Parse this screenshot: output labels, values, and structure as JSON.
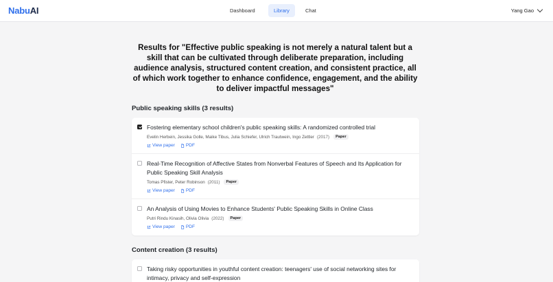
{
  "app": {
    "logo_part1": "Nabu",
    "logo_part2": "AI",
    "user_name": "Yang Gao"
  },
  "nav": {
    "items": [
      {
        "label": "Dashboard"
      },
      {
        "label": "Library"
      },
      {
        "label": "Chat"
      }
    ],
    "active": "Library"
  },
  "results_heading": "Results for \"Effective public speaking is not merely a natural talent but a skill that can be cultivated through deliberate preparation, including audience analysis, structured content creation, and consistent practice, all of which work together to enhance confidence, engagement, and the ability to deliver impactful messages\"",
  "sections": [
    {
      "title": "Public speaking skills (3 results)",
      "items": [
        {
          "checked": true,
          "title": "Fostering elementary school children's public speaking skills: A randomized controlled trial",
          "authors": "Evelin Herbein, Jessika Golle, Maike Tibus, Julia Schiefer, Ulrich Trautwein, Ingo Zettler",
          "year": "(2017)",
          "type": "Paper",
          "view_label": "View paper",
          "pdf_label": "PDF"
        },
        {
          "checked": false,
          "title": "Real-Time Recognition of Affective States from Nonverbal Features of Speech and Its Application for Public Speaking Skill Analysis",
          "authors": "Tomas Pfister, Peter Robinson",
          "year": "(2011)",
          "type": "Paper",
          "view_label": "View paper",
          "pdf_label": "PDF"
        },
        {
          "checked": false,
          "title": "An Analysis of Using Movies to Enhance Students' Public Speaking Skills in Online Class",
          "authors": "Putri Rindu Kinasih, Olivia Olivia",
          "year": "(2022)",
          "type": "Paper",
          "view_label": "View paper",
          "pdf_label": "PDF"
        }
      ]
    },
    {
      "title": "Content creation (3 results)",
      "items": [
        {
          "checked": false,
          "title": "Taking risky opportunities in youthful content creation: teenagers' use of social networking sites for intimacy, privacy and self-expression"
        }
      ]
    }
  ],
  "colors": {
    "accent": "#2f6feb",
    "logo_dark": "#1c2a4a",
    "page_bg": "#f5f5f6"
  },
  "icons": {
    "view_paper": "external-link-icon",
    "pdf": "document-icon",
    "user_menu": "chevron-down-icon"
  }
}
